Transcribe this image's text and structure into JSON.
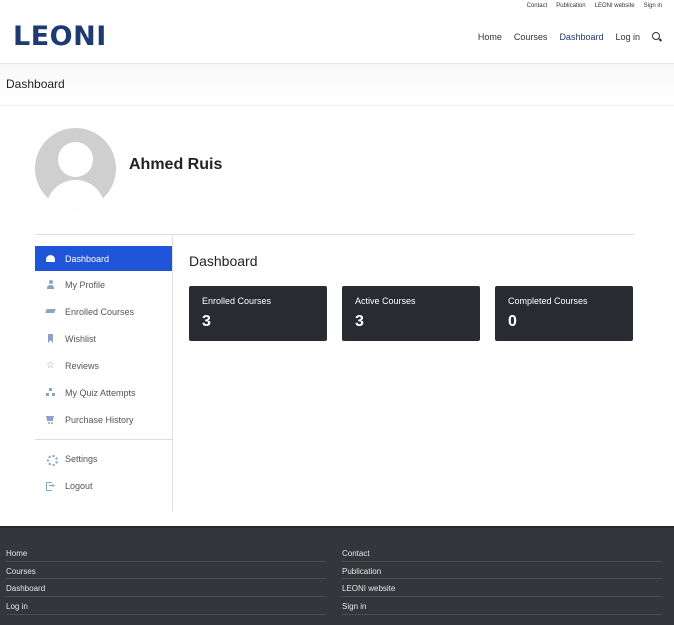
{
  "util_nav": [
    "Contact",
    "Publication",
    "LEONI website",
    "Sign in"
  ],
  "logo": "LEONI",
  "main_nav": {
    "home": "Home",
    "courses": "Courses",
    "dashboard": "Dashboard",
    "login": "Log in"
  },
  "breadcrumb": {
    "title": "Dashboard"
  },
  "profile": {
    "name": "Ahmed Ruis"
  },
  "sidebar": {
    "items": [
      {
        "label": "Dashboard",
        "icon": "dashboard-icon",
        "active": true
      },
      {
        "label": "My Profile",
        "icon": "user-icon"
      },
      {
        "label": "Enrolled Courses",
        "icon": "graduation-cap-icon"
      },
      {
        "label": "Wishlist",
        "icon": "bookmark-icon"
      },
      {
        "label": "Reviews",
        "icon": "star-icon"
      },
      {
        "label": "My Quiz Attempts",
        "icon": "sitemap-icon"
      },
      {
        "label": "Purchase History",
        "icon": "cart-icon"
      }
    ],
    "bottom_items": [
      {
        "label": "Settings",
        "icon": "gear-icon"
      },
      {
        "label": "Logout",
        "icon": "logout-icon"
      }
    ]
  },
  "main": {
    "title": "Dashboard",
    "cards": [
      {
        "label": "Enrolled Courses",
        "value": "3"
      },
      {
        "label": "Active Courses",
        "value": "3"
      },
      {
        "label": "Completed Courses",
        "value": "0"
      }
    ]
  },
  "footer": {
    "left": [
      "Home",
      "Courses",
      "Dashboard",
      "Log in"
    ],
    "right": [
      "Contact",
      "Publication",
      "LEONI website",
      "Sign in"
    ]
  },
  "colors": {
    "brand": "#1d3a73",
    "sidebar_active": "#1f55d9",
    "card_bg": "#292b33",
    "footer_bg": "#33363b"
  }
}
